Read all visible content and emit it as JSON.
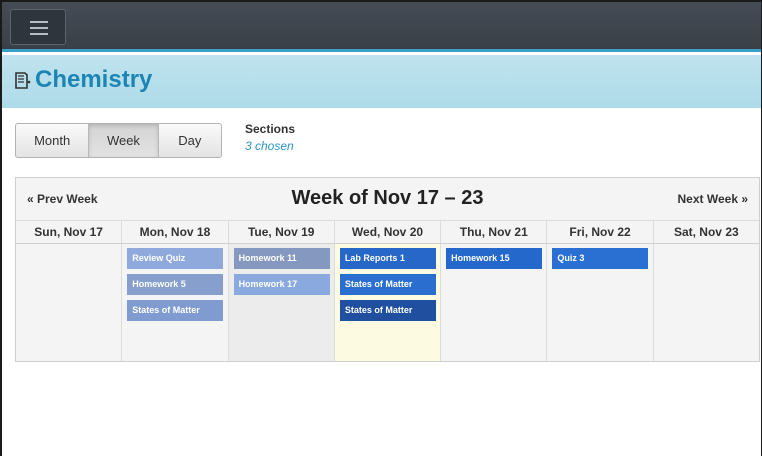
{
  "app": {
    "menu_icon": "hamburger-icon",
    "course_icon": "book-icon",
    "course_title": "Chemistry"
  },
  "colors": {
    "topbar": "#40464e",
    "accent": "#3aa0c6",
    "header_band": "#b7e0ec",
    "title": "#1d85b3",
    "today": "#fcfbe2"
  },
  "view_switcher": {
    "selected": "Week",
    "options": [
      {
        "label": "Month"
      },
      {
        "label": "Week"
      },
      {
        "label": "Day"
      }
    ]
  },
  "sections": {
    "label": "Sections",
    "value": "3 chosen"
  },
  "calendar": {
    "prev_label": "« Prev Week",
    "next_label": "Next Week »",
    "title": "Week of Nov 17 – 23",
    "days": [
      {
        "label": "Sun, Nov 17",
        "events": []
      },
      {
        "label": "Mon, Nov 18",
        "events": [
          {
            "title": "Review Quiz",
            "color": "#8fa9dc"
          },
          {
            "title": "Homework 5",
            "color": "#869fcc"
          },
          {
            "title": "States of Matter",
            "color": "#7f9bd0"
          }
        ]
      },
      {
        "label": "Tue, Nov 19",
        "events": [
          {
            "title": "Homework 11",
            "color": "#8598bf"
          },
          {
            "title": "Homework 17",
            "color": "#8aa9df"
          }
        ]
      },
      {
        "label": "Wed, Nov 20",
        "today": true,
        "events": [
          {
            "title": "Lab Reports 1",
            "color": "#2667c8"
          },
          {
            "title": "States of Matter",
            "color": "#2a6fd0"
          },
          {
            "title": "States of Matter",
            "color": "#1f4f9e"
          }
        ]
      },
      {
        "label": "Thu, Nov 21",
        "events": [
          {
            "title": "Homework 15",
            "color": "#2468cc"
          }
        ]
      },
      {
        "label": "Fri, Nov 22",
        "events": [
          {
            "title": "Quiz 3",
            "color": "#2a70d3"
          }
        ]
      },
      {
        "label": "Sat, Nov 23",
        "events": []
      }
    ]
  }
}
